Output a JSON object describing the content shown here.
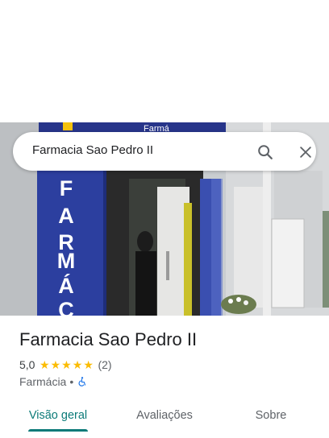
{
  "search": {
    "query": "Farmacia Sao Pedro II"
  },
  "photo": {
    "sign_letters": [
      "F",
      "A",
      "R",
      "M",
      "Á",
      "C"
    ],
    "top_sign_text": "Farmá"
  },
  "place": {
    "name": "Farmacia Sao Pedro II",
    "rating": "5,0",
    "stars": 5,
    "review_count": "(2)",
    "category": "Farmácia",
    "separator": "•",
    "attribute_icon": "wheelchair-accessible-icon"
  },
  "tabs": [
    {
      "label": "Visão geral",
      "active": true
    },
    {
      "label": "Avaliações",
      "active": false
    },
    {
      "label": "Sobre",
      "active": false
    }
  ],
  "colors": {
    "accent": "#0b7a78",
    "star": "#fbbc04",
    "sign_blue": "#2a3d9a",
    "access_blue": "#1a73e8"
  }
}
